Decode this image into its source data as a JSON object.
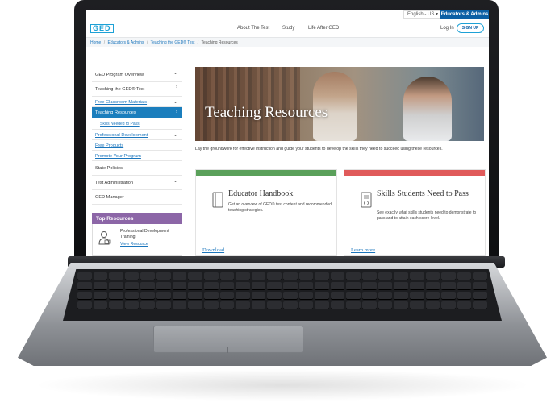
{
  "topbar": {
    "language": "English - US ▾",
    "educators_button": "Educators & Admins"
  },
  "header": {
    "logo": "GED",
    "nav": [
      "About The Test",
      "Study",
      "Life After GED"
    ],
    "login": "Log In",
    "signup": "SIGN UP"
  },
  "breadcrumb": {
    "items": [
      "Home",
      "Educators & Admins",
      "Teaching the GED® Test"
    ],
    "current": "Teaching Resources",
    "separator": "/"
  },
  "sidebar": {
    "items": [
      {
        "label": "GED Program Overview",
        "chevron": "⌄"
      },
      {
        "label": "Teaching the GED® Test",
        "chevron": "›"
      },
      {
        "label": "Free Classroom Materials",
        "chevron": "⌄"
      },
      {
        "label": "Teaching Resources",
        "chevron": "›"
      },
      {
        "label": "Skills Needed to Pass",
        "chevron": ""
      },
      {
        "label": "Professional Development",
        "chevron": "⌄"
      },
      {
        "label": "Free Products",
        "chevron": ""
      },
      {
        "label": "Promote Your Program",
        "chevron": ""
      },
      {
        "label": "State Policies",
        "chevron": ""
      },
      {
        "label": "Test Administration",
        "chevron": "⌄"
      },
      {
        "label": "GED Manager",
        "chevron": ""
      }
    ]
  },
  "top_resources": {
    "heading": "Top Resources",
    "title": "Professional Development Training",
    "link": "View Resource"
  },
  "hero": {
    "title": "Teaching Resources"
  },
  "lead": "Lay the groundwork for effective instruction and guide your students to develop the skills they need to succeed using these resources.",
  "cards": [
    {
      "title": "Educator Handbook",
      "description": "Get an overview of GED® test content and recommended teaching strategies.",
      "link": "Download",
      "accent": "#5aa05a",
      "icon": "book-icon"
    },
    {
      "title": "Skills Students Need to Pass",
      "description": "See exactly what skills students need to demonstrate to pass and to attain each score level.",
      "link": "Learn more",
      "accent": "#e05a5a",
      "icon": "checklist-icon"
    }
  ],
  "colors": {
    "brand_blue": "#1da1d6",
    "button_blue": "#0b5fa5",
    "active_item": "#1b7ebd",
    "top_resources": "#8c66a7"
  }
}
